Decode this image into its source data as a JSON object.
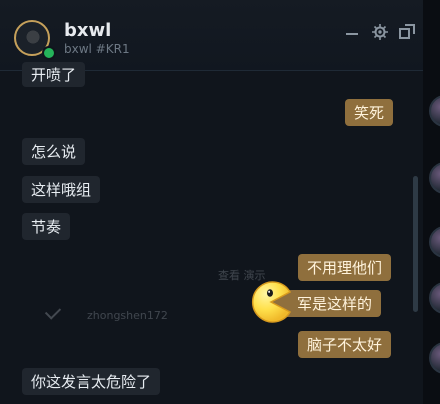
{
  "header": {
    "name": "bxwl",
    "tag": "bxwl #KR1"
  },
  "faded_overlay": {
    "line_1": "查看 演示",
    "line_2": "zhongshen172"
  },
  "messages": [
    {
      "text": "开喷了",
      "side": "incoming"
    },
    {
      "text": "笑死",
      "side": "outgoing"
    },
    {
      "text": "怎么说",
      "side": "incoming"
    },
    {
      "text": "这样哦组",
      "side": "incoming"
    },
    {
      "text": "节奏",
      "side": "incoming"
    },
    {
      "text": "不用理他们",
      "side": "outgoing"
    },
    {
      "text": "军是这样的",
      "side": "outgoing"
    },
    {
      "text": "脑子不太好",
      "side": "outgoing"
    },
    {
      "text": "你这发言太危险了",
      "side": "incoming"
    }
  ],
  "colors": {
    "incoming_bubble": "#20262e",
    "outgoing_bubble": "#8f6f3d",
    "accent_gold": "#c6a15b",
    "online_status": "#25b35a"
  },
  "icons": [
    "minimize-icon",
    "gear-icon",
    "popout-icon",
    "pacman-emoji"
  ]
}
